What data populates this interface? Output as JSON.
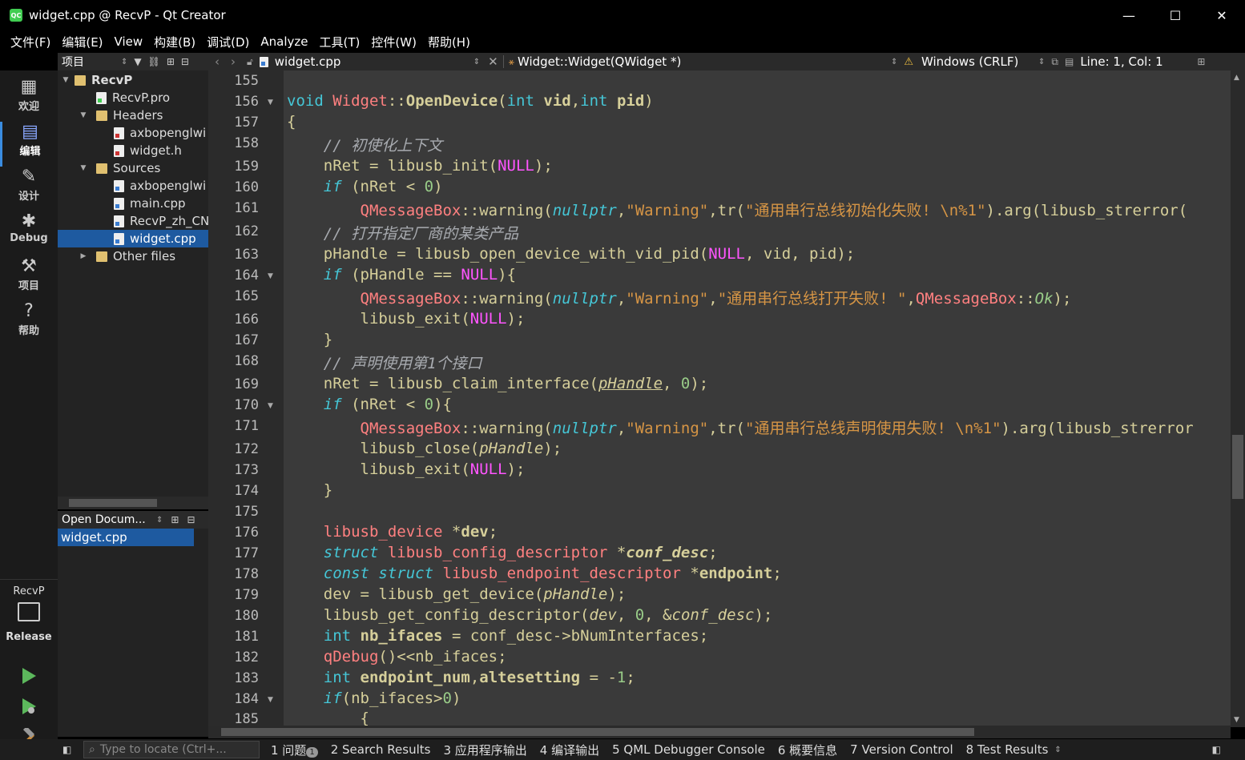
{
  "window": {
    "title": "widget.cpp @ RecvP - Qt Creator",
    "app_icon": "QC",
    "minimize": "—",
    "maximize": "☐",
    "close": "✕"
  },
  "menu": [
    "文件(F)",
    "编辑(E)",
    "View",
    "构建(B)",
    "调试(D)",
    "Analyze",
    "工具(T)",
    "控件(W)",
    "帮助(H)"
  ],
  "modes": [
    {
      "label": "欢迎",
      "icon": "welcome-grid-icon"
    },
    {
      "label": "编辑",
      "icon": "edit-document-icon"
    },
    {
      "label": "设计",
      "icon": "design-pencil-icon"
    },
    {
      "label": "Debug",
      "icon": "debug-bug-icon"
    },
    {
      "label": "项目",
      "icon": "projects-wrench-icon"
    },
    {
      "label": "帮助",
      "icon": "help-question-icon"
    }
  ],
  "kit": {
    "project": "RecvP",
    "config": "Release"
  },
  "project_panel": {
    "title": "项目",
    "tree": [
      {
        "label": "RecvP",
        "level": 0,
        "type": "project",
        "expanded": true
      },
      {
        "label": "RecvP.pro",
        "level": 1,
        "type": "pro"
      },
      {
        "label": "Headers",
        "level": 1,
        "type": "folder",
        "expanded": true
      },
      {
        "label": "axbopenglwi",
        "level": 2,
        "type": "h"
      },
      {
        "label": "widget.h",
        "level": 2,
        "type": "h"
      },
      {
        "label": "Sources",
        "level": 1,
        "type": "folder",
        "expanded": true
      },
      {
        "label": "axbopenglwi",
        "level": 2,
        "type": "c"
      },
      {
        "label": "main.cpp",
        "level": 2,
        "type": "c"
      },
      {
        "label": "RecvP_zh_CN",
        "level": 2,
        "type": "c"
      },
      {
        "label": "widget.cpp",
        "level": 2,
        "type": "c",
        "selected": true
      },
      {
        "label": "Other files",
        "level": 1,
        "type": "folder",
        "expanded": false
      }
    ]
  },
  "open_docs": {
    "title": "Open Docum...",
    "items": [
      "widget.cpp"
    ]
  },
  "editor_toolbar": {
    "file": "widget.cpp",
    "symbol": "Widget::Widget(QWidget *)",
    "encoding": "Windows (CRLF)",
    "position": "Line: 1, Col: 1"
  },
  "status_bar": {
    "locator_placeholder": "Type to locate (Ctrl+...",
    "panes": [
      "1 问题",
      "2 Search Results",
      "3 应用程序输出",
      "4 编译输出",
      "5 QML Debugger Console",
      "6 概要信息",
      "7 Version Control",
      "8 Test Results"
    ],
    "issues_count": "1"
  },
  "colors": {
    "accent": "#1e5aa0",
    "editor_bg": "#3a3a3a",
    "gutter_bg": "#2b2b2b"
  },
  "code_lines": [
    {
      "n": "155",
      "html": ""
    },
    {
      "n": "156",
      "fold": true,
      "html": "<span class=\"kw\">void</span> <span class=\"cls\">Widget</span>::<span class=\"fn\">OpenDevice</span>(<span class=\"kw\">int</span> <span class=\"bold\">vid</span>,<span class=\"kw\">int</span> <span class=\"bold\">pid</span>)"
    },
    {
      "n": "157",
      "html": "{"
    },
    {
      "n": "158",
      "html": "    <span class=\"cmt\">// 初使化上下文</span>"
    },
    {
      "n": "159",
      "html": "    nRet = libusb_init(<span class=\"mac\">NULL</span>);"
    },
    {
      "n": "160",
      "html": "    <span class=\"kw it\">if</span> (nRet &lt; <span class=\"nm\">0</span>)"
    },
    {
      "n": "161",
      "html": "        <span class=\"cls\">QMessageBox</span>::warning(<span class=\"kw it\">nullptr</span>,<span class=\"str\">\"Warning\"</span>,tr(<span class=\"str\">\"通用串行总线初始化失败! \\n%1\"</span>).arg(libusb_strerror("
    },
    {
      "n": "162",
      "html": "    <span class=\"cmt\">// 打开指定厂商的某类产品</span>"
    },
    {
      "n": "163",
      "html": "    pHandle = libusb_open_device_with_vid_pid(<span class=\"mac\">NULL</span>, vid, pid);"
    },
    {
      "n": "164",
      "fold": true,
      "html": "    <span class=\"kw it\">if</span> (pHandle == <span class=\"mac\">NULL</span>){"
    },
    {
      "n": "165",
      "html": "        <span class=\"cls\">QMessageBox</span>::warning(<span class=\"kw it\">nullptr</span>,<span class=\"str\">\"Warning\"</span>,<span class=\"str\">\"通用串行总线打开失败! \"</span>,<span class=\"cls\">QMessageBox</span>::<span class=\"nm it\">Ok</span>);"
    },
    {
      "n": "166",
      "html": "        libusb_exit(<span class=\"mac\">NULL</span>);"
    },
    {
      "n": "167",
      "html": "    }"
    },
    {
      "n": "168",
      "html": "    <span class=\"cmt\">// 声明使用第1个接口</span>"
    },
    {
      "n": "169",
      "html": "    nRet = libusb_claim_interface(<span class=\"ul\">pHandle</span>, <span class=\"nm\">0</span>);"
    },
    {
      "n": "170",
      "fold": true,
      "html": "    <span class=\"kw it\">if</span> (nRet &lt; <span class=\"nm\">0</span>){"
    },
    {
      "n": "171",
      "html": "        <span class=\"cls\">QMessageBox</span>::warning(<span class=\"kw it\">nullptr</span>,<span class=\"str\">\"Warning\"</span>,tr(<span class=\"str\">\"通用串行总线声明使用失败! \\n%1\"</span>).arg(libusb_strerror"
    },
    {
      "n": "172",
      "html": "        libusb_close(<span class=\"it\">pHandle</span>);"
    },
    {
      "n": "173",
      "html": "        libusb_exit(<span class=\"mac\">NULL</span>);"
    },
    {
      "n": "174",
      "html": "    }"
    },
    {
      "n": "175",
      "html": ""
    },
    {
      "n": "176",
      "html": "    <span class=\"cls\">libusb_device</span> *<span class=\"bold\">dev</span>;"
    },
    {
      "n": "177",
      "html": "    <span class=\"kw it\">struct</span> <span class=\"cls\">libusb_config_descriptor</span> *<span class=\"bold it\">conf_desc</span>;"
    },
    {
      "n": "178",
      "html": "    <span class=\"kw it\">const</span> <span class=\"kw it\">struct</span> <span class=\"cls\">libusb_endpoint_descriptor</span> *<span class=\"bold\">endpoint</span>;"
    },
    {
      "n": "179",
      "html": "    dev = libusb_get_device(<span class=\"it\">pHandle</span>);"
    },
    {
      "n": "180",
      "html": "    libusb_get_config_descriptor(<span class=\"it\">dev</span>, <span class=\"nm\">0</span>, &amp;<span class=\"it\">conf_desc</span>);"
    },
    {
      "n": "181",
      "html": "    <span class=\"kw\">int</span> <span class=\"bold\">nb_ifaces</span> = conf_desc-&gt;bNumInterfaces;"
    },
    {
      "n": "182",
      "html": "    <span class=\"cls\">qDebug</span>()&lt;&lt;nb_ifaces;"
    },
    {
      "n": "183",
      "html": "    <span class=\"kw\">int</span> <span class=\"bold\">endpoint_num</span>,<span class=\"bold\">altesetting</span> = -<span class=\"nm\">1</span>;"
    },
    {
      "n": "184",
      "fold": true,
      "html": "    <span class=\"kw it\">if</span>(nb_ifaces&gt;<span class=\"nm\">0</span>)"
    },
    {
      "n": "185",
      "html": "        {"
    }
  ]
}
